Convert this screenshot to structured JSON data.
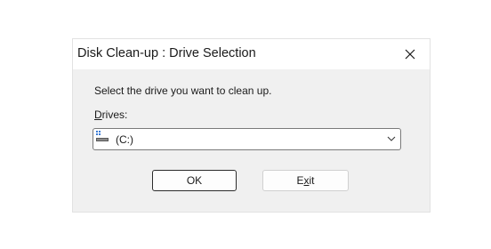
{
  "window": {
    "title": "Disk Clean-up : Drive Selection"
  },
  "prompt": "Select the drive you want to clean up.",
  "drives": {
    "label_accel": "D",
    "label_rest": "rives:",
    "selected": "(C:)"
  },
  "buttons": {
    "ok": "OK",
    "exit_pre": "E",
    "exit_accel": "x",
    "exit_post": "it"
  },
  "icons": {
    "close": "close-icon",
    "drive": "drive-icon",
    "dropdown": "chevron-down-icon"
  }
}
